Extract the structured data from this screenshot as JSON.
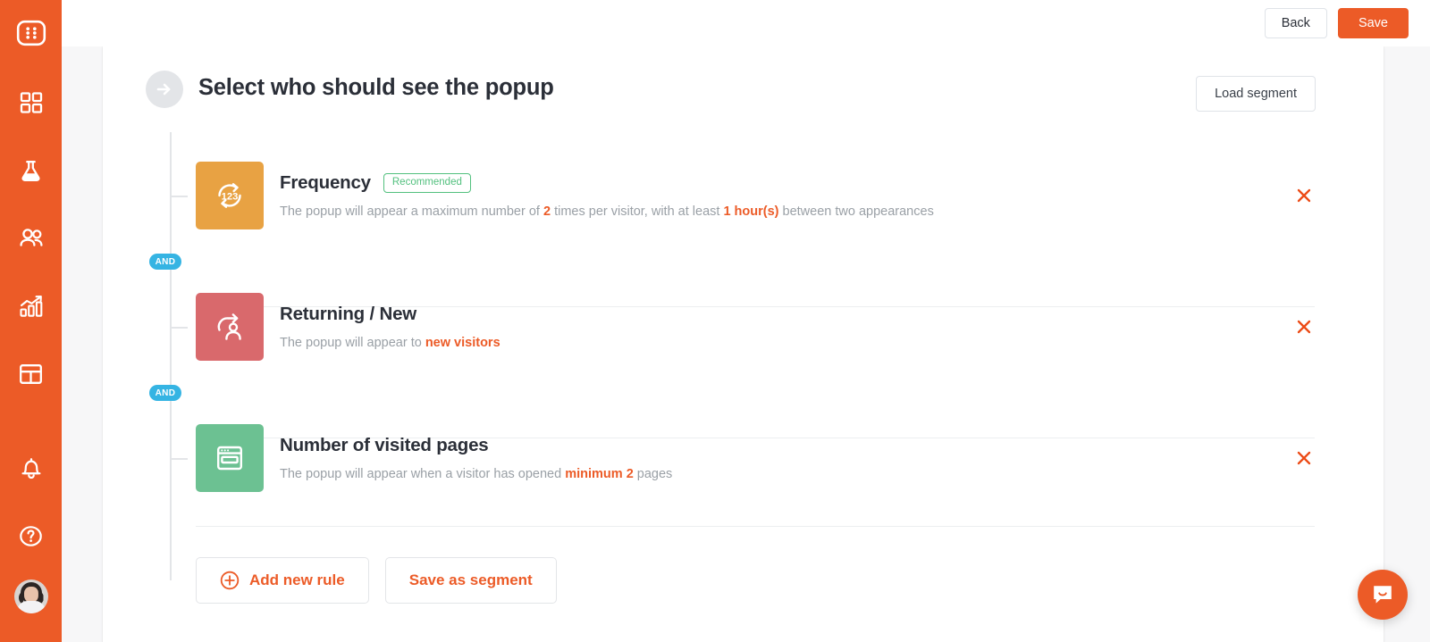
{
  "brand": {
    "accent": "#ec5b27",
    "badge_and_color": "#35b4e3",
    "recommended_color": "#52c07e"
  },
  "sidebar": {
    "logo": {
      "name": "app-logo",
      "icon": "grid-dots-logo-icon"
    },
    "items": [
      {
        "name": "sidebar-item-dashboard",
        "icon": "squares-icon",
        "label": "Dashboard"
      },
      {
        "name": "sidebar-item-experiments",
        "icon": "flask-icon",
        "label": "Experiments"
      },
      {
        "name": "sidebar-item-audience",
        "icon": "people-icon",
        "label": "Audience"
      },
      {
        "name": "sidebar-item-analytics",
        "icon": "bar-chart-growth-icon",
        "label": "Analytics"
      },
      {
        "name": "sidebar-item-templates",
        "icon": "layout-icon",
        "label": "Templates"
      },
      {
        "name": "sidebar-item-notifications",
        "icon": "bell-icon",
        "label": "Notifications"
      },
      {
        "name": "sidebar-item-help",
        "icon": "question-circle-icon",
        "label": "Help"
      }
    ],
    "avatar": {
      "name": "user-avatar",
      "label": "User profile"
    }
  },
  "topbar": {
    "back_label": "Back",
    "save_label": "Save"
  },
  "header": {
    "arrow_icon": "arrow-right-circle-icon",
    "title": "Select who should see the popup",
    "load_segment_label": "Load segment"
  },
  "connector": {
    "and_label": "AND"
  },
  "rules": [
    {
      "name": "rule-frequency",
      "icon": "frequency-123-loop-icon",
      "icon_bg": "#e8a243",
      "title": "Frequency",
      "badge": "Recommended",
      "desc_parts": [
        {
          "text": "The popup will appear a maximum number of ",
          "bold": false
        },
        {
          "text": "2",
          "bold": true
        },
        {
          "text": " times per visitor, with at least ",
          "bold": false
        },
        {
          "text": "1 hour(s)",
          "bold": true
        },
        {
          "text": " between two appearances",
          "bold": false
        }
      ],
      "close_label": "Remove rule"
    },
    {
      "name": "rule-returning-new",
      "icon": "returning-visitor-arrow-person-icon",
      "icon_bg": "#d9696c",
      "title": "Returning / New",
      "badge": null,
      "desc_parts": [
        {
          "text": "The popup will appear to ",
          "bold": false
        },
        {
          "text": "new visitors",
          "bold": true
        }
      ],
      "close_label": "Remove rule"
    },
    {
      "name": "rule-number-of-visited-pages",
      "icon": "browser-window-pages-icon",
      "icon_bg": "#6cc192",
      "title": "Number of visited pages",
      "badge": null,
      "desc_parts": [
        {
          "text": "The popup will appear when a visitor has opened ",
          "bold": false
        },
        {
          "text": "minimum 2",
          "bold": true
        },
        {
          "text": " pages",
          "bold": false
        }
      ],
      "close_label": "Remove rule"
    }
  ],
  "footer": {
    "add_rule_label": "Add new rule",
    "add_rule_icon": "plus-circle-icon",
    "save_segment_label": "Save as segment"
  },
  "intercom": {
    "name": "intercom-launcher",
    "icon": "chat-bubble-smile-icon",
    "label": "Open messenger"
  }
}
